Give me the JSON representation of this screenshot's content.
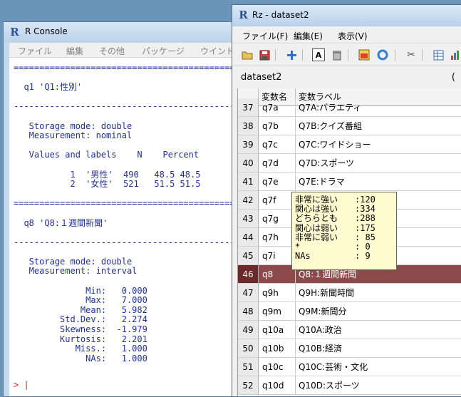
{
  "r_console": {
    "title": "R Console",
    "menu": [
      "ファイル",
      "編集",
      "その他",
      "パッケージ",
      "ウインドウ"
    ],
    "lines": [
      "==================================================",
      "",
      "  q1 'Q1:性別'",
      "",
      "--------------------------------------------------",
      "",
      "   Storage mode: double",
      "   Measurement: nominal",
      "",
      "   Values and labels    N    Percent",
      "",
      "           1  '男性'  490   48.5 48.5",
      "           2  '女性'  521   51.5 51.5",
      "",
      "==================================================",
      "",
      "  q8 'Q8:１週間新聞'",
      "",
      "--------------------------------------------------",
      "",
      "   Storage mode: double",
      "   Measurement: interval",
      "",
      "              Min:   0.000",
      "              Max:   7.000",
      "             Mean:   5.982",
      "         Std.Dev.:   2.274",
      "         Skewness:  -1.979",
      "         Kurtosis:   2.201",
      "            Miss.:   1.000",
      "              NAs:   1.000"
    ],
    "prompt": "> |"
  },
  "rz": {
    "title": "Rz - dataset2",
    "menu": [
      "ファイル(F)",
      "編集(E)",
      "表示(V)"
    ],
    "dataset_label": "dataset2",
    "dataset_right": "(",
    "columns": {
      "var": "変数名",
      "label": "変数ラベル"
    },
    "rows": [
      {
        "num": "37",
        "var": "q7a",
        "label": "Q7A:バラエティ"
      },
      {
        "num": "38",
        "var": "q7b",
        "label": "Q7B:クイズ番組"
      },
      {
        "num": "39",
        "var": "q7c",
        "label": "Q7C:ワイドショー"
      },
      {
        "num": "40",
        "var": "q7d",
        "label": "Q7D:スポーツ"
      },
      {
        "num": "41",
        "var": "q7e",
        "label": "Q7E:ドラマ"
      },
      {
        "num": "42",
        "var": "q7f",
        "label": ""
      },
      {
        "num": "43",
        "var": "q7g",
        "label": ""
      },
      {
        "num": "44",
        "var": "q7h",
        "label": ""
      },
      {
        "num": "45",
        "var": "q7i",
        "label": ""
      },
      {
        "num": "46",
        "var": "q8",
        "label": "Q8:１週間新聞",
        "selected": true
      },
      {
        "num": "47",
        "var": "q9h",
        "label": "Q9H:新聞時間"
      },
      {
        "num": "48",
        "var": "q9m",
        "label": "Q9M:新聞分"
      },
      {
        "num": "49",
        "var": "q10a",
        "label": "Q10A:政治"
      },
      {
        "num": "50",
        "var": "q10b",
        "label": "Q10B:経済"
      },
      {
        "num": "51",
        "var": "q10c",
        "label": "Q10C:芸術・文化"
      },
      {
        "num": "52",
        "var": "q10d",
        "label": "Q10D:スポーツ"
      }
    ],
    "tooltip": [
      {
        "label": "非常に強い",
        "value": ":120"
      },
      {
        "label": "関心は強い",
        "value": ":334"
      },
      {
        "label": "どちらとも",
        "value": ":288"
      },
      {
        "label": "関心は弱い",
        "value": ":175"
      },
      {
        "label": "非常に弱い",
        "value": ": 85"
      },
      {
        "label": "*",
        "value": ":  0"
      },
      {
        "label": "NAs",
        "value": ":  9"
      }
    ]
  }
}
